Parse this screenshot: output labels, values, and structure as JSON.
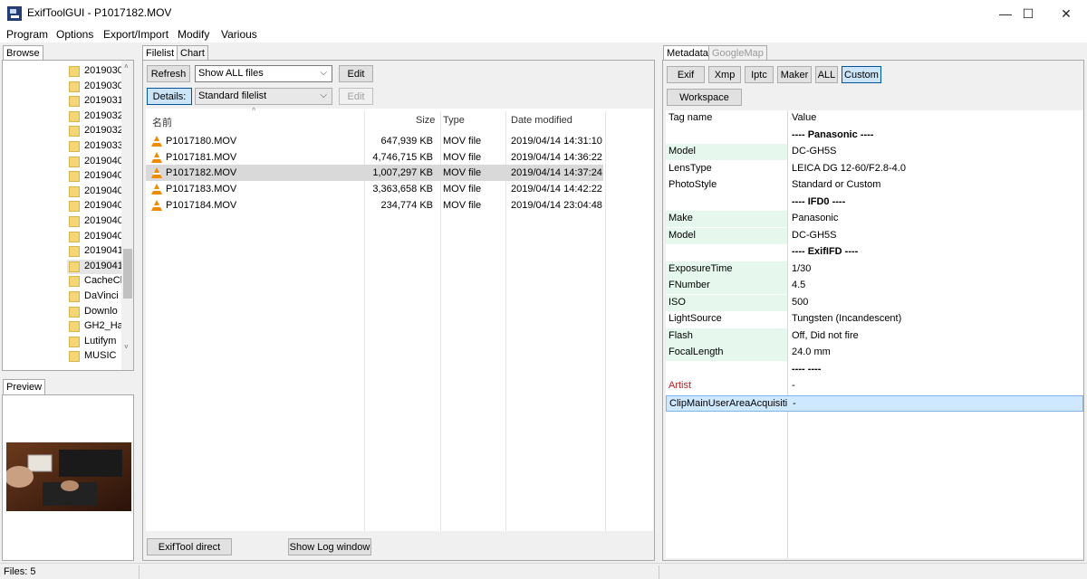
{
  "window": {
    "title": "ExifToolGUI - P1017182.MOV",
    "minimize": "—",
    "maximize": "☐",
    "close": "✕"
  },
  "menu": [
    "Program",
    "Options",
    "Export/Import",
    "Modify",
    "Various"
  ],
  "left": {
    "browse_tab": "Browse",
    "folders": [
      "2019030",
      "2019030",
      "2019031",
      "2019032",
      "2019032",
      "2019033",
      "2019040",
      "2019040",
      "2019040",
      "2019040",
      "2019040",
      "2019040",
      "2019041",
      "2019041",
      "CacheCl",
      "DaVinci",
      "Downlo",
      "GH2_Ha",
      "Lutifym",
      "MUSIC"
    ],
    "selected_folder_index": 13,
    "preview_tab": "Preview"
  },
  "filelist": {
    "tabs": [
      "Filelist",
      "Chart"
    ],
    "refresh_label": "Refresh",
    "filter_value": "Show ALL files",
    "edit_label": "Edit",
    "details_label": "Details:",
    "view_value": "Standard filelist",
    "edit2_label": "Edit",
    "columns": [
      "名前",
      "Size",
      "Type",
      "Date modified"
    ],
    "rows": [
      {
        "name": "P1017180.MOV",
        "size": "647,939 KB",
        "type": "MOV file",
        "date": "2019/04/14 14:31:10"
      },
      {
        "name": "P1017181.MOV",
        "size": "4,746,715 KB",
        "type": "MOV file",
        "date": "2019/04/14 14:36:22"
      },
      {
        "name": "P1017182.MOV",
        "size": "1,007,297 KB",
        "type": "MOV file",
        "date": "2019/04/14 14:37:24"
      },
      {
        "name": "P1017183.MOV",
        "size": "3,363,658 KB",
        "type": "MOV file",
        "date": "2019/04/14 14:42:22"
      },
      {
        "name": "P1017184.MOV",
        "size": "234,774 KB",
        "type": "MOV file",
        "date": "2019/04/14 23:04:48"
      }
    ],
    "selected_row_index": 2,
    "exiftool_direct_label": "ExifTool direct",
    "show_log_label": "Show Log window"
  },
  "metadata": {
    "tabs": [
      "Metadata",
      "GoogleMap"
    ],
    "filter_buttons": [
      "Exif",
      "Xmp",
      "Iptc",
      "Maker",
      "ALL",
      "Custom"
    ],
    "active_filter": "Custom",
    "workspace_label": "Workspace",
    "header_tag": "Tag name",
    "header_value": "Value",
    "rows": [
      {
        "tag": "",
        "value": "---- Panasonic ----",
        "kind": "group"
      },
      {
        "tag": "Model",
        "value": "DC-GH5S",
        "kind": "hl"
      },
      {
        "tag": "LensType",
        "value": "LEICA DG 12-60/F2.8-4.0",
        "kind": "plain"
      },
      {
        "tag": "PhotoStyle",
        "value": "Standard or Custom",
        "kind": "plain"
      },
      {
        "tag": "",
        "value": "---- IFD0 ----",
        "kind": "group"
      },
      {
        "tag": "Make",
        "value": "Panasonic",
        "kind": "hl"
      },
      {
        "tag": "Model",
        "value": "DC-GH5S",
        "kind": "hl"
      },
      {
        "tag": "",
        "value": "---- ExifIFD ----",
        "kind": "group"
      },
      {
        "tag": "ExposureTime",
        "value": "1/30",
        "kind": "hl"
      },
      {
        "tag": "FNumber",
        "value": "4.5",
        "kind": "hl"
      },
      {
        "tag": "ISO",
        "value": "500",
        "kind": "hl"
      },
      {
        "tag": "LightSource",
        "value": "Tungsten (Incandescent)",
        "kind": "plain"
      },
      {
        "tag": "Flash",
        "value": "Off, Did not fire",
        "kind": "hl"
      },
      {
        "tag": "FocalLength",
        "value": "24.0 mm",
        "kind": "hl"
      },
      {
        "tag": "",
        "value": "----  ----",
        "kind": "group"
      },
      {
        "tag": "Artist",
        "value": "-",
        "kind": "red"
      },
      {
        "tag": "ClipMainUserAreaAcquisiti",
        "value": "-",
        "kind": "selected"
      }
    ]
  },
  "status": {
    "files": "Files: 5"
  },
  "colors": {
    "selection_blue": "#cde8ff",
    "tag_highlight": "#e6f8ee",
    "artist_red": "#b22222",
    "vlc_orange": "#f08a00"
  }
}
